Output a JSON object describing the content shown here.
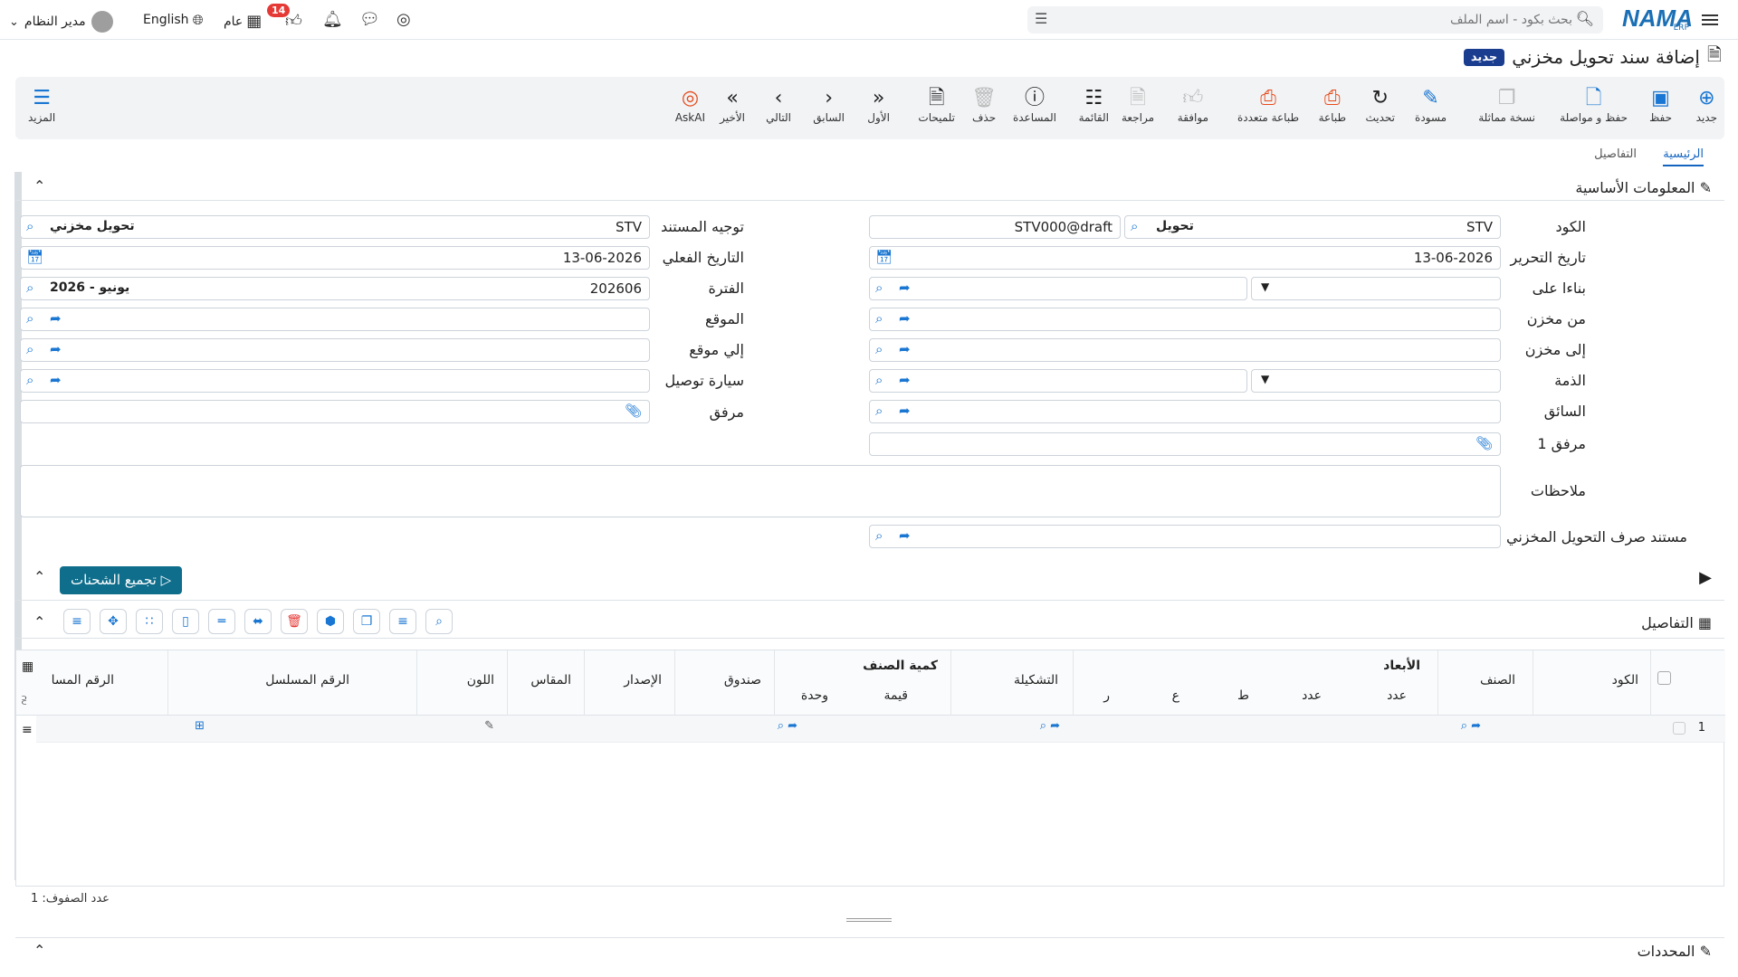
{
  "topbar": {
    "logo": "NAMA",
    "logo_sub": "ERP",
    "search_placeholder": "بحث بكود - اسم الملف",
    "user_name": "مدير النظام",
    "language": "English",
    "general": "عام",
    "badge_count": "14"
  },
  "page": {
    "title": "إضافة سند تحويل مخزني",
    "badge": "جديد"
  },
  "toolbar": {
    "new": "جديد",
    "save": "حفظ",
    "save_continue": "حفظ و مواصلة",
    "copy": "نسخة مماثلة",
    "draft": "مسودة",
    "refresh": "تحديث",
    "print": "طباعة",
    "multi_print": "طباعة متعددة",
    "approve": "موافقة",
    "review": "مراجعة",
    "list": "القائمة",
    "help": "المساعدة",
    "delete": "حذف",
    "hints": "تلميحات",
    "first": "الأول",
    "previous": "السابق",
    "next": "التالي",
    "last": "الأخير",
    "askai": "AskAI",
    "more": "المزيد"
  },
  "tabs": {
    "main": "الرئيسية",
    "details": "التفاصيل"
  },
  "sections": {
    "basic_info": "المعلومات الأساسية",
    "details": "التفاصيل",
    "determinants": "المحددات"
  },
  "form": {
    "code_label": "الكود",
    "code_value": "STV",
    "code_type": "تحويل",
    "code_number": "STV000@draft",
    "doc_direction_label": "توجيه المستند",
    "doc_direction_code": "STV",
    "doc_direction_name": "تحويل مخزني",
    "edit_date_label": "تاريخ التحرير",
    "edit_date_value": "13-06-2026",
    "actual_date_label": "التاريخ الفعلي",
    "actual_date_value": "13-06-2026",
    "based_on_label": "بناءا على",
    "period_label": "الفترة",
    "period_code": "202606",
    "period_name": "2026 - يونيو",
    "from_store_label": "من مخزن",
    "location_label": "الموقع",
    "to_store_label": "إلى مخزن",
    "to_location_label": "إلي موقع",
    "liability_label": "الذمة",
    "delivery_car_label": "سيارة توصيل",
    "driver_label": "السائق",
    "attachment_label": "مرفق",
    "attachment1_label": "مرفق 1",
    "notes_label": "ملاحظات",
    "issue_doc_label": "مستند صرف التحويل المخزني"
  },
  "shipment_button": "تجميع الشحنات",
  "grid": {
    "columns": {
      "code": "الكود",
      "item": "الصنف",
      "dimensions_group": "الأبعاد",
      "count1": "عدد",
      "count2": "عدد",
      "t": "ط",
      "a": "ع",
      "r": "ر",
      "formation": "التشكيلة",
      "qty_group": "كمية الصنف",
      "value": "قيمة",
      "unit": "وحدة",
      "box": "صندوق",
      "version": "الإصدار",
      "size": "المقاس",
      "color": "اللون",
      "serial": "الرقم المسلسل",
      "serial2": "الرقم المسا"
    },
    "rows": [
      {
        "index": "1"
      }
    ]
  },
  "row_count": "عدد الصفوف: 1"
}
